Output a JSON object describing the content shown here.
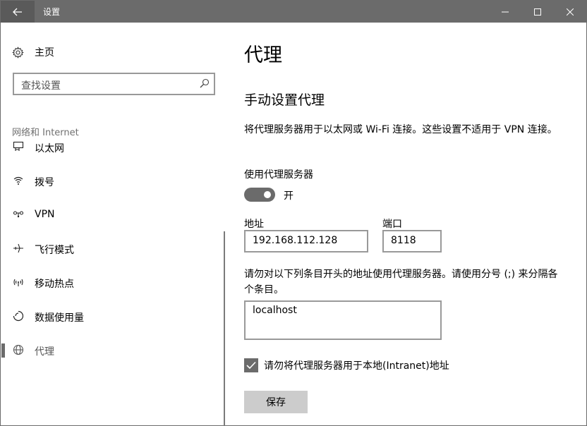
{
  "window": {
    "title": "设置"
  },
  "sidebar": {
    "home_label": "主页",
    "search_placeholder": "查找设置",
    "section_label": "网络和 Internet",
    "items": [
      {
        "label": "以太网",
        "icon": "ethernet-icon"
      },
      {
        "label": "拨号",
        "icon": "dialup-icon"
      },
      {
        "label": "VPN",
        "icon": "vpn-icon"
      },
      {
        "label": "飞行模式",
        "icon": "airplane-icon"
      },
      {
        "label": "移动热点",
        "icon": "hotspot-icon"
      },
      {
        "label": "数据使用量",
        "icon": "data-usage-icon"
      },
      {
        "label": "代理",
        "icon": "globe-icon",
        "active": true
      }
    ]
  },
  "main": {
    "title": "代理",
    "manual_heading": "手动设置代理",
    "description": "将代理服务器用于以太网或 Wi-Fi 连接。这些设置不适用于 VPN 连接。",
    "use_proxy_label": "使用代理服务器",
    "toggle_state": "开",
    "toggle_on": true,
    "address_label": "地址",
    "address_value": "192.168.112.128",
    "port_label": "端口",
    "port_value": "8118",
    "exceptions_description": "请勿对以下列条目开头的地址使用代理服务器。请使用分号 (;) 来分隔各个条目。",
    "exceptions_value": "localhost",
    "bypass_local_label": "请勿将代理服务器用于本地(Intranet)地址",
    "bypass_local_checked": true,
    "save_label": "保存"
  },
  "colors": {
    "titlebar": "#6b6b6b",
    "accent_gray": "#6b6b6b",
    "save_button": "#cccccc"
  }
}
